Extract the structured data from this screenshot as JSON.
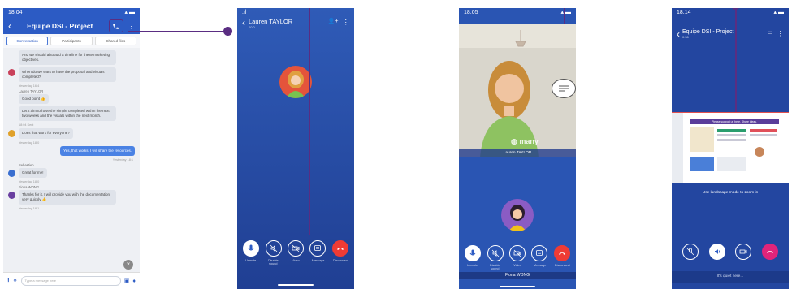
{
  "colors": {
    "brand_blue": "#2c5bc4",
    "hangup_red": "#ef3b34",
    "callout_purple": "#5a2d82"
  },
  "phone1": {
    "status_time": "18:04",
    "title": "Equipe DSI - Project",
    "tabs": [
      "Conversation",
      "Participants",
      "Shared files"
    ],
    "messages": [
      {
        "text": "And we should also add a timeline for these marketing objectives."
      },
      {
        "text": "When do we want to have the proposal and visuals completed?",
        "meta": "Yesterday 16:4"
      },
      {
        "sender": "Lauren TAYLOR",
        "text": "Good point"
      },
      {
        "text": "Let's aim to have the simple completed within the next two weeks and the visuals within the next month.",
        "meta": "18:04 Sent"
      },
      {
        "text": "Does that work for everyone?",
        "meta": "Yesterday 18:0"
      },
      {
        "me": true,
        "text": "Yes, that works. I will share the resources.",
        "meta": "Yesterday 18:1"
      },
      {
        "sender": "Sebastien",
        "text": "Great for me!",
        "meta": "Yesterday 18:0"
      },
      {
        "sender": "Fiona WONG",
        "text": "Thanks for it, I will provide you with the documentation very quickly",
        "meta": "Yesterday 18:1"
      }
    ],
    "input_placeholder": "Type a message here"
  },
  "phone2": {
    "caller_name": "Lauren TAYLOR",
    "caller_sub": "00:0",
    "labels": [
      "Unmute",
      "Disable sound",
      "Video",
      "Message",
      "Disconnect"
    ]
  },
  "phone3": {
    "status_time": "18:05",
    "video_brand": "many",
    "remote_name": "Lauren TAYLOR",
    "self_name": "Fiona WONG",
    "labels": [
      "Unmute",
      "Disable sound",
      "Video",
      "Message",
      "Disconnect"
    ]
  },
  "phone4": {
    "status_time": "18:14",
    "title": "Equipe DSI - Project",
    "subtitle": "0:56",
    "share_header": "Please support us here. Share ideas.",
    "hint": "Use landscape mode to zoom in",
    "footer": "It's quiet here..."
  }
}
